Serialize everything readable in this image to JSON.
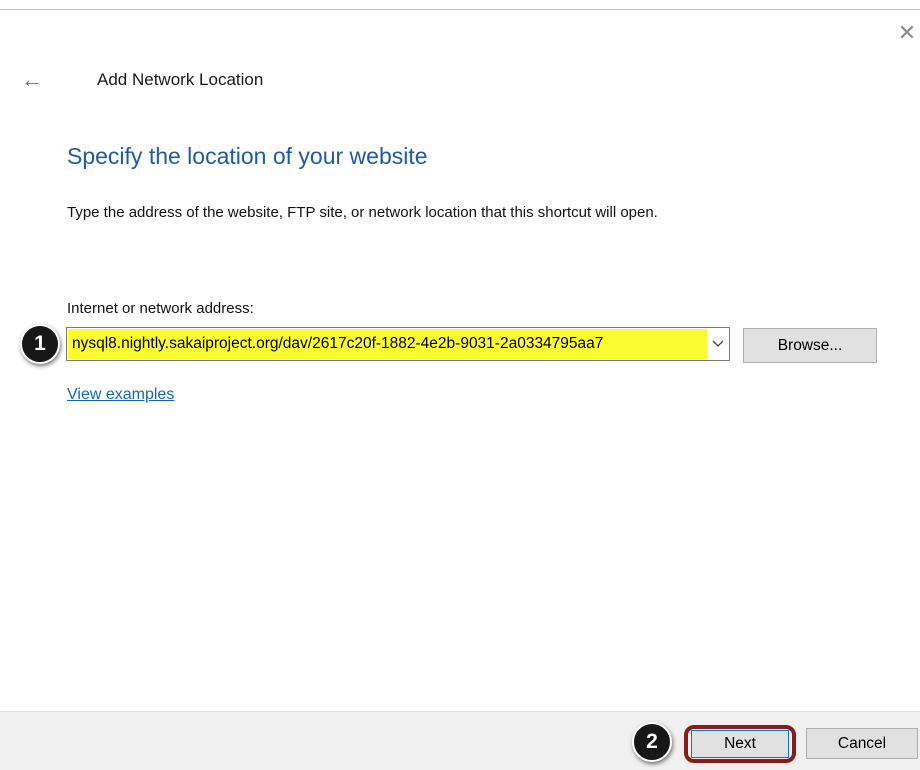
{
  "window": {
    "title": "Add Network Location",
    "close_icon": "close-icon",
    "back_icon": "back-arrow-icon"
  },
  "main": {
    "heading": "Specify the location of your website",
    "instructions": "Type the address of the website, FTP site, or network location that this shortcut will open.",
    "address_label": "Internet or network address:",
    "address_value": "nysql8.nightly.sakaiproject.org/dav/2617c20f-1882-4e2b-9031-2a0334795aa7",
    "browse_label": "Browse...",
    "view_examples_label": "View examples"
  },
  "footer": {
    "next_label": "Next",
    "cancel_label": "Cancel"
  },
  "annotations": {
    "callout_1": "1",
    "callout_2": "2"
  },
  "colors": {
    "heading": "#1f5ba7",
    "link": "#1565c0",
    "address_highlight": "#fbfb32",
    "next_highlight_border": "#8b1a1a",
    "callout_background": "#171717"
  }
}
